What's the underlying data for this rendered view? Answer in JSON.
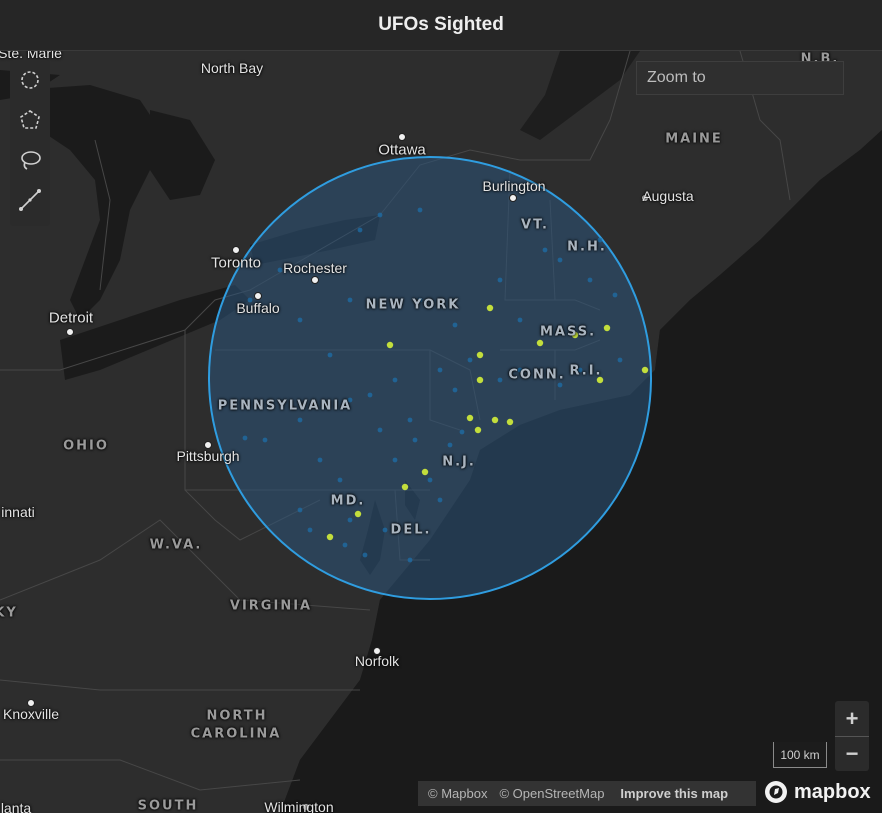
{
  "header": {
    "title": "UFOs Sighted"
  },
  "search": {
    "placeholder": "Zoom to"
  },
  "draw_tools": [
    {
      "name": "circle-draw-icon"
    },
    {
      "name": "polygon-draw-icon"
    },
    {
      "name": "lasso-draw-icon"
    },
    {
      "name": "line-draw-icon"
    }
  ],
  "zoom_controls": {
    "zoom_in": "+",
    "zoom_out": "−"
  },
  "scale": {
    "label": "100 km"
  },
  "attribution": {
    "mapbox": "© Mapbox",
    "osm": "© OpenStreetMap",
    "improve": "Improve this map"
  },
  "logo": {
    "text": "mapbox"
  },
  "map_labels": {
    "cities": {
      "ste_marie": "Ste. Marie",
      "north_bay": "North Bay",
      "ottawa": "Ottawa",
      "burlington": "Burlington",
      "augusta": "Augusta",
      "toronto": "Toronto",
      "rochester": "Rochester",
      "buffalo": "Buffalo",
      "detroit": "Detroit",
      "pittsburgh": "Pittsburgh",
      "cincinnati": "innati",
      "norfolk": "Norfolk",
      "knoxville": "Knoxville",
      "wilmington": "Wilmington",
      "atlanta": "lanta"
    },
    "regions": {
      "maine": "MAINE",
      "nb": "N.B.",
      "vt": "VT.",
      "nh": "N.H.",
      "new_york": "NEW YORK",
      "mass": "MASS.",
      "conn": "CONN.",
      "ri": "R.I.",
      "pennsylvania": "PENNSYLVANIA",
      "ohio": "OHIO",
      "nj": "N.J.",
      "md": "MD.",
      "del": "DEL.",
      "wva": "W.VA.",
      "virginia": "VIRGINIA",
      "ky": "KY",
      "north": "NORTH",
      "carolina": "CAROLINA",
      "south": "SOUTH"
    }
  },
  "colors": {
    "background": "#1b1b1b",
    "land": "#2c2c2c",
    "water": "#1a1a1a",
    "selection_stroke": "#2f9de0",
    "selection_fill": "#2a4f72",
    "sighting_low": "#1e6fa8",
    "sighting_high": "#d4f03a"
  }
}
